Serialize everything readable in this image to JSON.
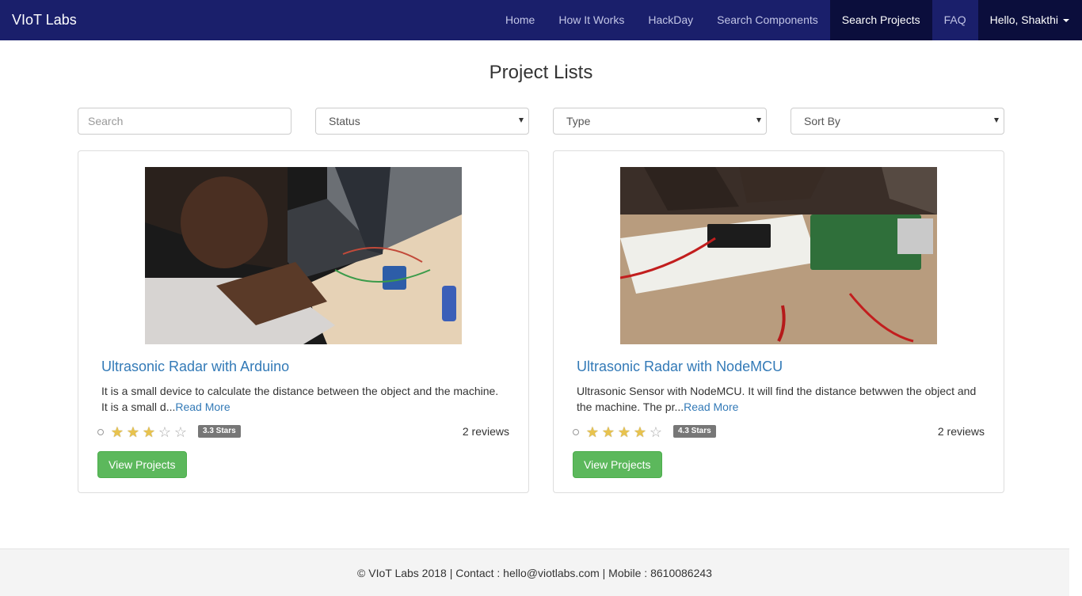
{
  "navbar": {
    "brand": "VIoT Labs",
    "items": [
      {
        "label": "Home"
      },
      {
        "label": "How It Works"
      },
      {
        "label": "HackDay"
      },
      {
        "label": "Search Components"
      },
      {
        "label": "Search Projects"
      },
      {
        "label": "FAQ"
      }
    ],
    "active": "Search Projects",
    "user_label": "Hello, Shakthi"
  },
  "page": {
    "title": "Project Lists"
  },
  "filters": {
    "search_placeholder": "Search",
    "status_value": "Status",
    "type_value": "Type",
    "sort_value": "Sort By"
  },
  "projects": [
    {
      "title": "Ultrasonic Radar with Arduino",
      "description": "It is a small device to calculate the distance between the object and the machine. It is a small d...",
      "read_more": "Read More",
      "rating": 3.3,
      "rating_badge": "3.3 Stars",
      "reviews": "2 reviews",
      "button": "View Projects"
    },
    {
      "title": "Ultrasonic Radar with NodeMCU",
      "description": "Ultrasonic Sensor with NodeMCU. It will find the distance betwwen the object and the machine. The pr...",
      "read_more": "Read More",
      "rating": 4.3,
      "rating_badge": "4.3 Stars",
      "reviews": "2 reviews",
      "button": "View Projects"
    }
  ],
  "footer": {
    "text": "© VIoT Labs 2018 | Contact : hello@viotlabs.com | Mobile : 8610086243"
  },
  "colors": {
    "navbar_bg": "#1a1f6b",
    "navbar_active_bg": "#0b0e3c",
    "link": "#337ab7",
    "button_green": "#5cb85c",
    "badge_gray": "#777777",
    "star_gold": "#e8c34e"
  },
  "icons": {
    "caret": "caret-down-icon",
    "select_arrow": "dropdown-arrow-icon",
    "star": "star-icon",
    "clear": "rating-clear-icon"
  }
}
